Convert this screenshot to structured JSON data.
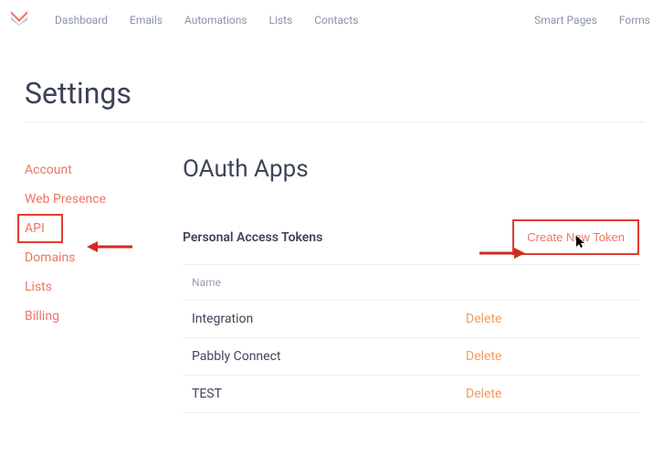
{
  "nav": {
    "left": [
      "Dashboard",
      "Emails",
      "Automations",
      "Lists",
      "Contacts"
    ],
    "right": [
      "Smart Pages",
      "Forms"
    ]
  },
  "page_title": "Settings",
  "sidebar": {
    "items": [
      {
        "label": "Account"
      },
      {
        "label": "Web Presence"
      },
      {
        "label": "API",
        "highlighted": true
      },
      {
        "label": "Domains"
      },
      {
        "label": "Lists"
      },
      {
        "label": "Billing"
      }
    ]
  },
  "content": {
    "heading": "OAuth Apps",
    "section_label": "Personal Access Tokens",
    "create_label": "Create New Token",
    "table": {
      "header": "Name",
      "rows": [
        {
          "name": "Integration",
          "action": "Delete"
        },
        {
          "name": "Pabbly Connect",
          "action": "Delete"
        },
        {
          "name": "TEST",
          "action": "Delete"
        }
      ]
    }
  }
}
